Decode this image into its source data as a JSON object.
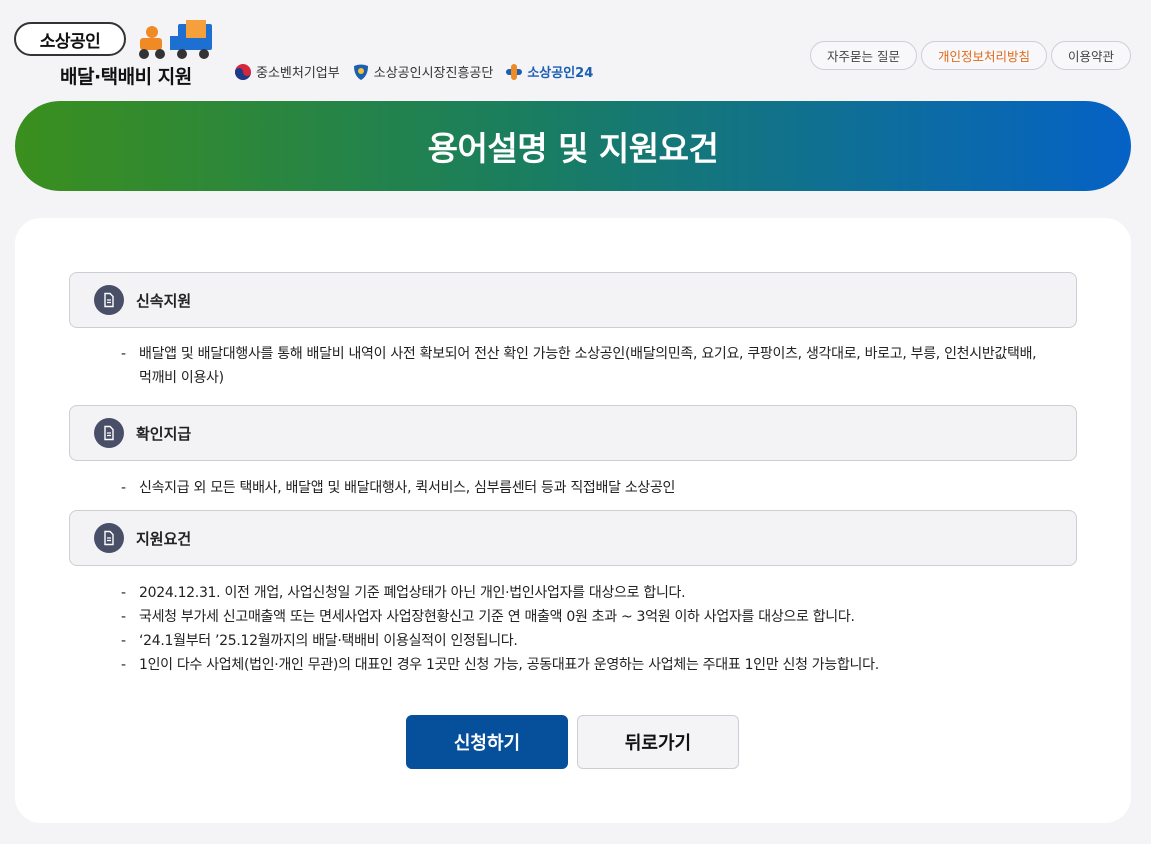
{
  "header": {
    "logo_title": "소상공인",
    "logo_subtitle": "배달·택배비 지원",
    "partners": [
      "중소벤처기업부",
      "소상공인시장진흥공단",
      "소상공인24"
    ],
    "links": [
      "자주묻는 질문",
      "개인정보처리방침",
      "이용약관"
    ]
  },
  "banner": {
    "title": "용어설명 및 지원요건"
  },
  "sections": [
    {
      "title": "신속지원",
      "items": [
        "배달앱 및 배달대행사를 통해 배달비 내역이 사전 확보되어 전산 확인 가능한 소상공인(배달의민족, 요기요, 쿠팡이츠, 생각대로, 바로고, 부릉, 인천시반값택배, 먹깨비 이용사)"
      ]
    },
    {
      "title": "확인지급",
      "items": [
        "신속지급 외 모든 택배사, 배달앱 및 배달대행사, 퀵서비스, 심부름센터 등과 직접배달 소상공인"
      ]
    },
    {
      "title": "지원요건",
      "items": [
        "2024.12.31. 이전 개업, 사업신청일 기준 폐업상태가 아닌 개인·법인사업자를 대상으로 합니다.",
        "국세청 부가세 신고매출액 또는 면세사업자 사업장현황신고 기준 연 매출액 0원 초과 ~ 3억원 이하 사업자를 대상으로 합니다.",
        "‘24.1월부터 ’25.12월까지의 배달·택배비 이용실적이 인정됩니다.",
        "1인이 다수 사업체(법인·개인 무관)의 대표인 경우 1곳만 신청 가능, 공동대표가 운영하는 사업체는 주대표 1인만 신청 가능합니다."
      ]
    }
  ],
  "buttons": {
    "apply": "신청하기",
    "back": "뒤로가기"
  },
  "colors": {
    "primary": "#064f9a",
    "banner_start": "#3b8f1d",
    "banner_end": "#0562c6",
    "privacy_link": "#e06a1a"
  }
}
